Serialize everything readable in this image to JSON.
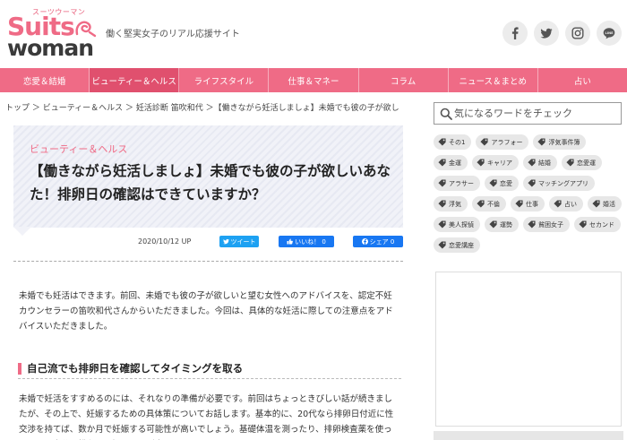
{
  "site": {
    "logo_kana": "スーツウーマン",
    "logo_suits": "Suits",
    "logo_woman": "woman",
    "tagline": "働く堅実女子のリアル応援サイト",
    "brand_color": "#ef6b86",
    "social": [
      {
        "icon": "facebook-icon"
      },
      {
        "icon": "twitter-icon"
      },
      {
        "icon": "instagram-icon"
      },
      {
        "icon": "line-icon",
        "label": "LINE"
      }
    ]
  },
  "nav": {
    "items": [
      {
        "label": "恋愛＆結婚",
        "active": false
      },
      {
        "label": "ビューティー＆ヘルス",
        "active": true
      },
      {
        "label": "ライフスタイル",
        "active": false
      },
      {
        "label": "仕事＆マネー",
        "active": false
      },
      {
        "label": "コラム",
        "active": false
      },
      {
        "label": "ニュース＆まとめ",
        "active": false
      },
      {
        "label": "占い",
        "active": false
      }
    ]
  },
  "breadcrumb": {
    "text": "トップ ＞ ビューティー＆ヘルス ＞ 妊活診断 笛吹和代 ＞【働きながら妊活しましょ】未婚でも彼の子が欲しいあ…"
  },
  "article": {
    "category": "ビューティー＆ヘルス",
    "title": "【働きながら妊活しましょ】未婚でも彼の子が欲しいあなた！排卵日の確認はできていますか？",
    "date": "2020/10/12 UP",
    "tweet_label": "ツイート",
    "like_label": "いいね！ 0",
    "share_label": "シェア 0",
    "intro": "未婚でも妊活はできます。前回、未婚でも彼の子が欲しいと望む女性へのアドバイスを、認定不妊カウンセラーの笛吹和代さんからいただきました。今回は、具体的な妊活に際しての注意点をアドバイスいただきました。",
    "subhead": "自己流でも排卵日を確認してタイミングを取る",
    "body": "未婚で妊活をすすめるのには、それなりの準備が必要です。前回はちょっときびしい話が続きましたが、その上で、妊娠するための具体策についてお話します。基本的に、20代なら排卵日付近に性交渉を持てば、数か月で妊娠する可能性が高いでしょう。基礎体温を測ったり、排卵検査薬を使ったりして自分の排卵日を知ることが大切です。"
  },
  "sidebar": {
    "search_placeholder": "気になるワードをチェック",
    "tags": [
      "その1",
      "アラフォー",
      "浮気事件簿",
      "金運",
      "キャリア",
      "結婚",
      "恋愛運",
      "アラサー",
      "恋愛",
      "マッチングアプリ",
      "浮気",
      "不倫",
      "仕事",
      "占い",
      "婚活",
      "美人探偵",
      "運勢",
      "貧困女子",
      "セカンド",
      "恋愛講座"
    ]
  }
}
